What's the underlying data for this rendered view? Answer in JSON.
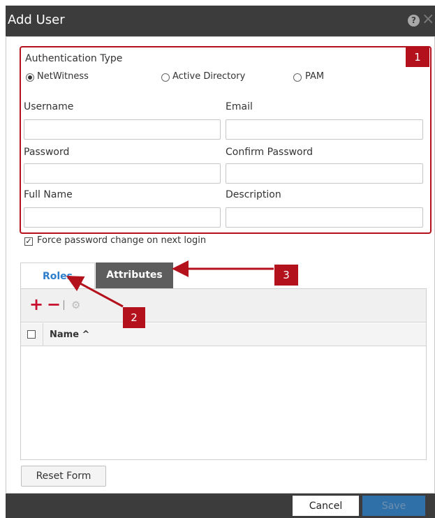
{
  "dialog": {
    "title": "Add User",
    "help_icon_glyph": "?",
    "close_icon_glyph": "×"
  },
  "auth": {
    "heading": "Authentication Type",
    "options": [
      "NetWitness",
      "Active Directory",
      "PAM"
    ],
    "selected": "NetWitness"
  },
  "fields": {
    "username": {
      "label": "Username",
      "value": ""
    },
    "email": {
      "label": "Email",
      "value": ""
    },
    "password": {
      "label": "Password",
      "value": ""
    },
    "confirm_password": {
      "label": "Confirm Password",
      "value": ""
    },
    "full_name": {
      "label": "Full Name",
      "value": ""
    },
    "description": {
      "label": "Description",
      "value": ""
    }
  },
  "force_password": {
    "label": "Force password change on next login",
    "checked": true,
    "check_glyph": "✓"
  },
  "tabs": [
    {
      "label": "Roles",
      "active": true
    },
    {
      "label": "Attributes",
      "active": false
    }
  ],
  "toolbar": {
    "add_glyph": "+",
    "remove_glyph": "−",
    "edit_glyph": "⚙"
  },
  "grid": {
    "column_name": "Name ^"
  },
  "buttons": {
    "reset": "Reset Form",
    "cancel": "Cancel",
    "save": "Save"
  },
  "callouts": [
    "1",
    "2",
    "3"
  ],
  "colors": {
    "accent_red": "#b3121c",
    "tab_blue": "#2f7ecb",
    "save_blue": "#2f70a8",
    "titlebar": "#3c3c3c"
  },
  "icons": [
    "help-icon",
    "close-icon",
    "plus-icon",
    "minus-icon",
    "gear-icon",
    "sort-icon",
    "check-icon"
  ]
}
